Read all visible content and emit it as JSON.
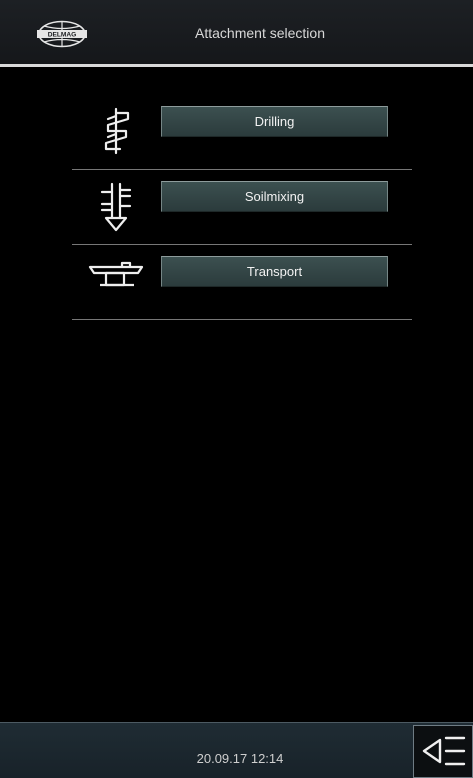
{
  "header": {
    "brand_logo": "Delmag",
    "title": "Attachment selection"
  },
  "attachments": [
    {
      "label": "Drilling",
      "icon": "auger-drill-icon"
    },
    {
      "label": "Soilmixing",
      "icon": "soilmixing-tool-icon"
    },
    {
      "label": "Transport",
      "icon": "transport-attachment-icon"
    }
  ],
  "footer": {
    "datetime": "20.09.17 12:14",
    "menu_icon": "menu-collapse-icon"
  },
  "colors": {
    "background": "#000000",
    "button_fill": "#34474a",
    "button_border": "#768686",
    "header_line": "#d9d9d9",
    "footer_fill": "#1c2730"
  }
}
